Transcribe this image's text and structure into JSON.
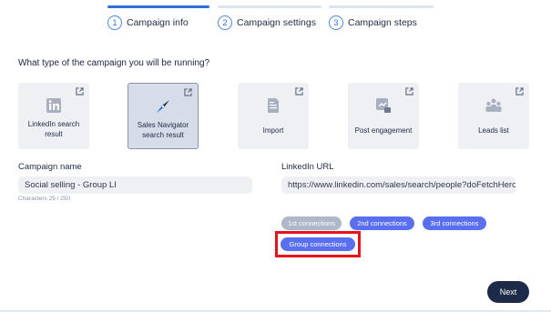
{
  "steps": [
    {
      "number": "1",
      "label": "Campaign info",
      "progress": 1.0
    },
    {
      "number": "2",
      "label": "Campaign settings",
      "progress": 0.0
    },
    {
      "number": "3",
      "label": "Campaign steps",
      "progress": 0.0
    }
  ],
  "question": "What type of the campaign you will be running?",
  "campaign_types": [
    {
      "label": "LinkedIn search result",
      "icon": "linkedin-icon",
      "selected": false
    },
    {
      "label": "Sales Navigator search result",
      "icon": "compass-icon",
      "selected": true
    },
    {
      "label": "Import",
      "icon": "document-icon",
      "selected": false
    },
    {
      "label": "Post engagement",
      "icon": "post-engagement-icon",
      "selected": false
    },
    {
      "label": "Leads list",
      "icon": "people-group-icon",
      "selected": false
    }
  ],
  "campaign_name": {
    "label": "Campaign name",
    "value": "Social selling - Group LI",
    "char_count": "Characters 25 / 250"
  },
  "linkedin_url": {
    "label": "LinkedIn URL",
    "value": "https://www.linkedin.com/sales/search/people?doFetchHero"
  },
  "connection_filters": [
    {
      "label": "1st connections",
      "active": false
    },
    {
      "label": "2nd connections",
      "active": true
    },
    {
      "label": "3rd connections",
      "active": true
    },
    {
      "label": "Group connections",
      "active": true
    }
  ],
  "next_label": "Next",
  "colors": {
    "accent": "#5a6ff0",
    "primary_dark": "#1e2a4a",
    "highlight": "#e8121b"
  }
}
